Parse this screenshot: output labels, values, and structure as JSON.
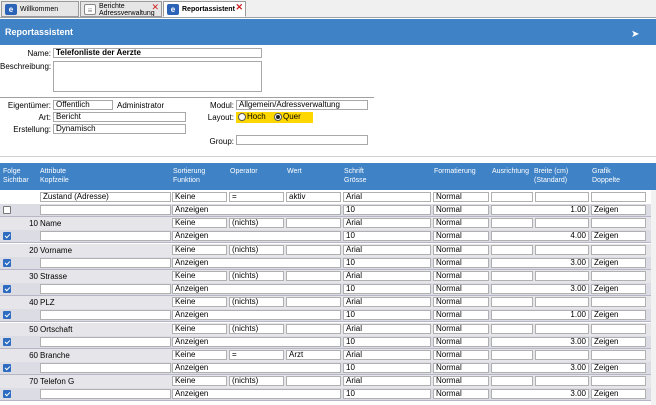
{
  "tabs": [
    {
      "label": "Willkommen"
    },
    {
      "label_line1": "Berichte",
      "label_line2": "Adressverwaltung"
    },
    {
      "label": "Reportassistent"
    }
  ],
  "tab_close": "✕",
  "header": {
    "title": "Reportassistent"
  },
  "form": {
    "name_label": "Name:",
    "name_value": "Telefonliste der Aerzte",
    "beschreibung_label": "Beschreibung:",
    "beschreibung_value": "",
    "eigentuemer_label": "Eigentümer:",
    "eigentuemer_value": "Öffentlich",
    "eigentuemer_user": "Administrator",
    "art_label": "Art:",
    "art_value": "Bericht",
    "erstellung_label": "Erstellung:",
    "erstellung_value": "Dynamisch",
    "modul_label": "Modul:",
    "modul_value": "Allgemein/Adressverwaltung",
    "layout_label": "Layout:",
    "layout_options": [
      "Hoch",
      "Quer"
    ],
    "layout_selected": "Quer",
    "group_label": "Group:",
    "group_value": ""
  },
  "columns": {
    "folge": "Folge",
    "sichtbar": "Sichtbar",
    "attribute": "Attribute",
    "kopfzeile": "Kopfzeile",
    "sortierung": "Sortierung",
    "funktion": "Funktion",
    "operator": "Operator",
    "wert": "Wert",
    "schrift": "Schrift",
    "groesse": "Grösse",
    "formatierung": "Formatierung",
    "ausrichtung": "Ausrichtung",
    "breite": "Breite (cm)",
    "standard": "(Standard)",
    "grafik": "Grafik",
    "doppelte": "Doppelte"
  },
  "rows": [
    {
      "folge": "",
      "attribute": "Zustand (Adresse)",
      "sichtbar": false,
      "kopfzeile": "",
      "sort": "Keine",
      "funktion": "Anzeigen",
      "operator": "=",
      "wert": "aktiv",
      "schrift": "Arial",
      "groesse": "10",
      "format1": "Normal",
      "format2": "Normal",
      "breite": "1.00",
      "doppelte": "Zeigen"
    },
    {
      "folge": "10",
      "attribute": "Name",
      "sichtbar": true,
      "kopfzeile": "",
      "sort": "Keine",
      "funktion": "Anzeigen",
      "operator": "(nichts)",
      "wert": "",
      "schrift": "Arial",
      "groesse": "10",
      "format1": "Normal",
      "format2": "Normal",
      "breite": "4.00",
      "doppelte": "Zeigen"
    },
    {
      "folge": "20",
      "attribute": "Vorname",
      "sichtbar": true,
      "kopfzeile": "",
      "sort": "Keine",
      "funktion": "Anzeigen",
      "operator": "(nichts)",
      "wert": "",
      "schrift": "Arial",
      "groesse": "10",
      "format1": "Normal",
      "format2": "Normal",
      "breite": "3.00",
      "doppelte": "Zeigen"
    },
    {
      "folge": "30",
      "attribute": "Strasse",
      "sichtbar": true,
      "kopfzeile": "",
      "sort": "Keine",
      "funktion": "Anzeigen",
      "operator": "(nichts)",
      "wert": "",
      "schrift": "Arial",
      "groesse": "10",
      "format1": "Normal",
      "format2": "Normal",
      "breite": "3.00",
      "doppelte": "Zeigen"
    },
    {
      "folge": "40",
      "attribute": "PLZ",
      "sichtbar": true,
      "kopfzeile": "",
      "sort": "Keine",
      "funktion": "Anzeigen",
      "operator": "(nichts)",
      "wert": "",
      "schrift": "Arial",
      "groesse": "10",
      "format1": "Normal",
      "format2": "Normal",
      "breite": "1.00",
      "doppelte": "Zeigen"
    },
    {
      "folge": "50",
      "attribute": "Ortschaft",
      "sichtbar": true,
      "kopfzeile": "",
      "sort": "Keine",
      "funktion": "Anzeigen",
      "operator": "(nichts)",
      "wert": "",
      "schrift": "Arial",
      "groesse": "10",
      "format1": "Normal",
      "format2": "Normal",
      "breite": "3.00",
      "doppelte": "Zeigen"
    },
    {
      "folge": "60",
      "attribute": "Branche",
      "sichtbar": true,
      "kopfzeile": "",
      "sort": "Keine",
      "funktion": "Anzeigen",
      "operator": "=",
      "wert": "Arzt",
      "schrift": "Arial",
      "groesse": "10",
      "format1": "Normal",
      "format2": "Normal",
      "breite": "3.00",
      "doppelte": "Zeigen"
    },
    {
      "folge": "70",
      "attribute": "Telefon G",
      "sichtbar": true,
      "kopfzeile": "",
      "sort": "Keine",
      "funktion": "Anzeigen",
      "operator": "(nichts)",
      "wert": "",
      "schrift": "Arial",
      "groesse": "10",
      "format1": "Normal",
      "format2": "Normal",
      "breite": "3.00",
      "doppelte": "Zeigen"
    }
  ],
  "colors": {
    "header_blue": "#3f82c6",
    "layout_highlight": "#ffd700",
    "tab_close": "#d02020"
  }
}
